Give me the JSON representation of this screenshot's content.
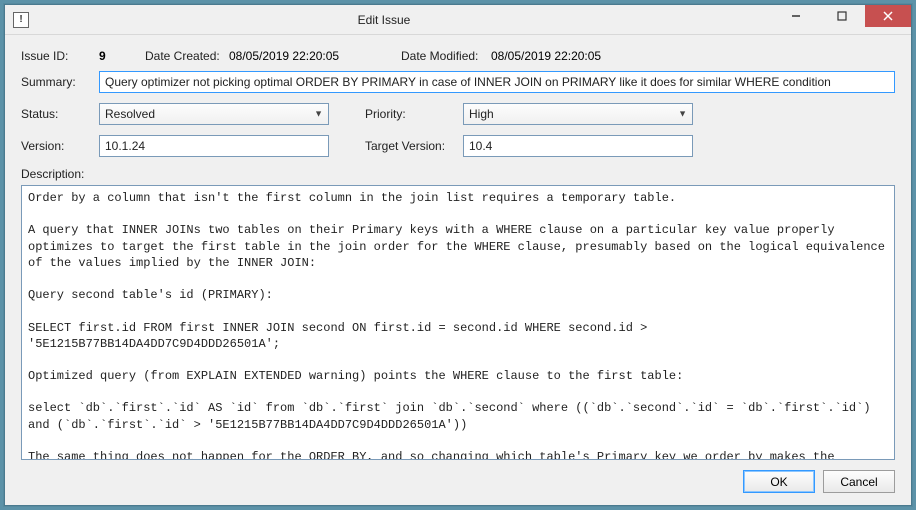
{
  "window": {
    "title": "Edit Issue"
  },
  "labels": {
    "issue_id": "Issue ID:",
    "date_created": "Date Created:",
    "date_modified": "Date Modified:",
    "summary": "Summary:",
    "status": "Status:",
    "priority": "Priority:",
    "version": "Version:",
    "target_version": "Target Version:",
    "description": "Description:"
  },
  "issue": {
    "id": "9",
    "date_created": "08/05/2019 22:20:05",
    "date_modified": "08/05/2019 22:20:05",
    "summary": "Query optimizer not picking optimal ORDER BY PRIMARY in case of INNER JOIN on PRIMARY like it does for similar WHERE condition",
    "status": "Resolved",
    "priority": "High",
    "version": "10.1.24",
    "target_version": "10.4",
    "description": "Order by a column that isn't the first column in the join list requires a temporary table.\n\nA query that INNER JOINs two tables on their Primary keys with a WHERE clause on a particular key value properly optimizes to target the first table in the join order for the WHERE clause, presumably based on the logical equivalence of the values implied by the INNER JOIN:\n\nQuery second table's id (PRIMARY):\n\nSELECT first.id FROM first INNER JOIN second ON first.id = second.id WHERE second.id > '5E1215B77BB14DA4DD7C9D4DDD26501A';\n\nOptimized query (from EXPLAIN EXTENDED warning) points the WHERE clause to the first table:\n\nselect `db`.`first`.`id` AS `id` from `db`.`first` join `db`.`second` where ((`db`.`second`.`id` = `db`.`first`.`id`) and (`db`.`first`.`id` > '5E1215B77BB14DA4DD7C9D4DDD26501A'))\n\nThe same thing does not happen for the ORDER BY, and so changing which table's Primary key we order by makes the difference between requiring a temporary table and not:\n"
  },
  "buttons": {
    "ok": "OK",
    "cancel": "Cancel"
  }
}
